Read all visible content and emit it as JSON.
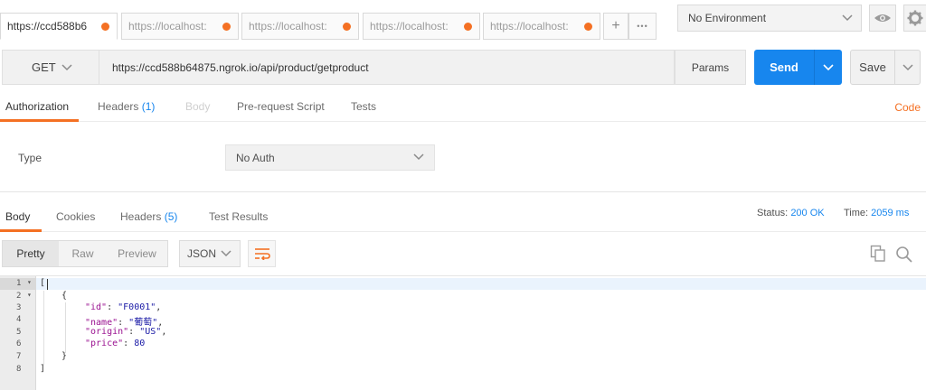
{
  "tabs": [
    {
      "label": "https://ccd588b6",
      "active": true
    },
    {
      "label": "https://localhost:",
      "active": false
    },
    {
      "label": "https://localhost:",
      "active": false
    },
    {
      "label": "https://localhost:",
      "active": false
    },
    {
      "label": "https://localhost:",
      "active": false
    }
  ],
  "tab_actions": {
    "add": "+",
    "more": "•••"
  },
  "environment": {
    "selected": "No Environment"
  },
  "request": {
    "method": "GET",
    "url": "https://ccd588b64875.ngrok.io/api/product/getproduct",
    "params_label": "Params",
    "send_label": "Send",
    "save_label": "Save"
  },
  "request_tabs": {
    "authorization": "Authorization",
    "headers": "Headers",
    "headers_count": "(1)",
    "body": "Body",
    "prerequest": "Pre-request Script",
    "tests": "Tests",
    "code": "Code"
  },
  "auth": {
    "type_label": "Type",
    "selected": "No Auth"
  },
  "response_tabs": {
    "body": "Body",
    "cookies": "Cookies",
    "headers": "Headers",
    "headers_count": "(5)",
    "test_results": "Test Results"
  },
  "response_status": {
    "status_label": "Status:",
    "status_value": "200 OK",
    "time_label": "Time:",
    "time_value": "2059 ms"
  },
  "view_modes": {
    "pretty": "Pretty",
    "raw": "Raw",
    "preview": "Preview"
  },
  "format": {
    "selected": "JSON"
  },
  "editor": {
    "line_numbers": [
      "1",
      "2",
      "3",
      "4",
      "5",
      "6",
      "7",
      "8"
    ],
    "lines": {
      "l1": "[",
      "l2": "{",
      "l3_key": "\"id\"",
      "l3_val": "\"F0001\"",
      "l4_key": "\"name\"",
      "l4_val": "\"葡萄\"",
      "l5_key": "\"origin\"",
      "l5_val": "\"US\"",
      "l6_key": "\"price\"",
      "l6_val": "80",
      "l7": "}",
      "l8": "]"
    }
  },
  "colors": {
    "accent": "#f47023",
    "primary": "#1786ee"
  }
}
